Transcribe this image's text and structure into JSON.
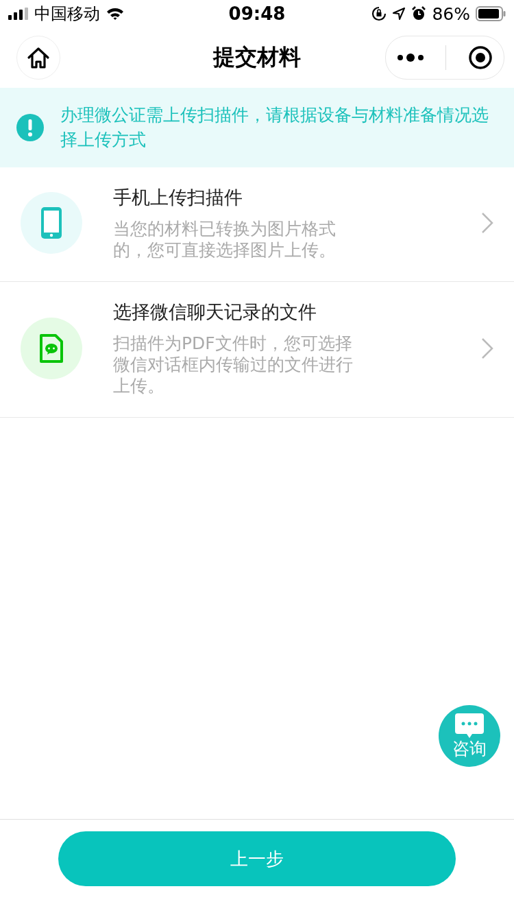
{
  "status_bar": {
    "carrier": "中国移动",
    "time": "09:48",
    "battery": "86%"
  },
  "nav": {
    "title": "提交材料"
  },
  "notice": {
    "text": "办理微公证需上传扫描件，请根据设备与材料准备情况选择上传方式"
  },
  "options": [
    {
      "kind": "phone",
      "title": "手机上传扫描件",
      "description": "当您的材料已转换为图片格式的，您可直接选择图片上传。"
    },
    {
      "kind": "chat-file",
      "title": "选择微信聊天记录的文件",
      "description": "扫描件为PDF文件时，您可选择微信对话框内传输过的文件进行上传。"
    }
  ],
  "consult": {
    "label": "咨询"
  },
  "footer": {
    "button": "上一步"
  }
}
